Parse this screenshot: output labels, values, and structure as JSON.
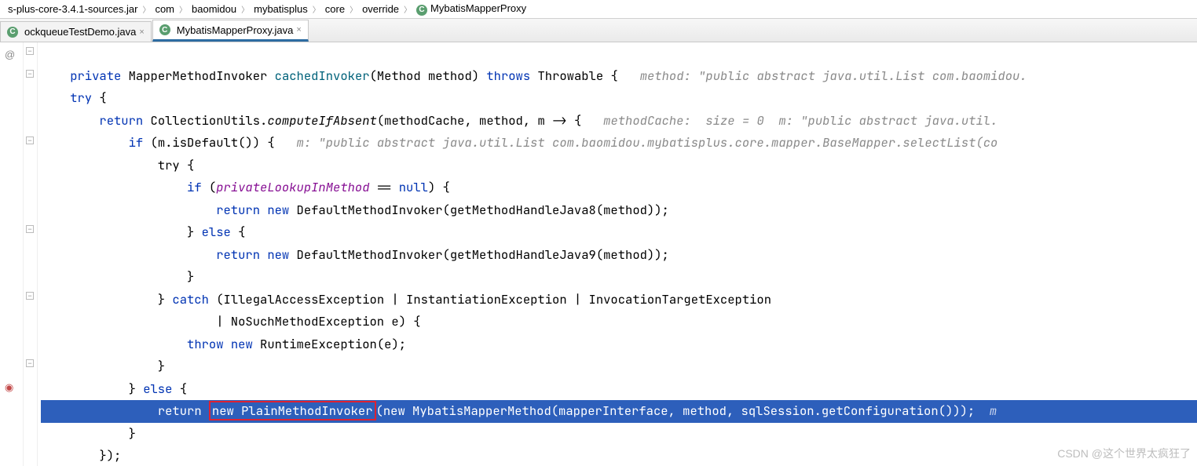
{
  "breadcrumb": [
    "s-plus-core-3.4.1-sources.jar",
    "com",
    "baomidou",
    "mybatisplus",
    "core",
    "override",
    "MybatisMapperProxy"
  ],
  "tabs": [
    {
      "name": "ockqueueTestDemo.java",
      "active": false
    },
    {
      "name": "MybatisMapperProxy.java",
      "active": true
    }
  ],
  "gutter_override": "@",
  "code": {
    "l1_kw1": "private",
    "l1_type": "MapperMethodInvoker",
    "l1_method": "cachedInvoker",
    "l1_sig": "(Method method) ",
    "l1_kw2": "throws",
    "l1_rest": " Throwable {   ",
    "l1_hint": "method: \"public abstract java.util.List com.baomidou.",
    "l2": "    try {",
    "l3_kw": "return",
    "l3_a": " CollectionUtils.",
    "l3_static": "computeIfAbsent",
    "l3_b": "(methodCache, method, m -> {   ",
    "l3_hint": "methodCache:  size = 0  m: \"public abstract java.util.",
    "l4_kw": "if",
    "l4_a": " (m.isDefault()) {   ",
    "l4_hint": "m: \"public abstract java.util.List com.baomidou.mybatisplus.core.mapper.BaseMapper.selectList(co",
    "l5": "                try {",
    "l6_kw": "if",
    "l6_a": " (",
    "l6_field": "privateLookupInMethod",
    "l6_b": " == ",
    "l6_kw2": "null",
    "l6_c": ") {",
    "l7_kw1": "return",
    "l7_kw2": "new",
    "l7_a": " DefaultMethodInvoker(getMethodHandleJava8(method));",
    "l8": "                    } ",
    "l8_kw": "else",
    "l8_b": " {",
    "l9_kw1": "return",
    "l9_kw2": "new",
    "l9_a": " DefaultMethodInvoker(getMethodHandleJava9(method));",
    "l10": "                    }",
    "l11a": "                } ",
    "l11_kw": "catch",
    "l11b": " (IllegalAccessException | InstantiationException | InvocationTargetException",
    "l12": "                        | NoSuchMethodException e) {",
    "l13_kw1": "throw",
    "l13_kw2": "new",
    "l13_a": " RuntimeException(e);",
    "l14": "                }",
    "l15a": "            } ",
    "l15_kw": "else",
    "l15b": " {",
    "l16_pad": "                ",
    "l16_kw1": "return ",
    "l16_kw2": "new",
    "l16_box": " PlainMethodInvoker",
    "l16_a": "(",
    "l16_kw3": "new",
    "l16_b": " MybatisMapperMethod(mapperInterface, method, sqlSession.getConfiguration()));  ",
    "l16_hint": "m",
    "l17": "            }",
    "l18": "        });"
  },
  "watermark": "CSDN @这个世界太疯狂了",
  "colors": {
    "keyword": "#0033b3",
    "hl": "#2d5fbb",
    "redbox": "#d23"
  }
}
